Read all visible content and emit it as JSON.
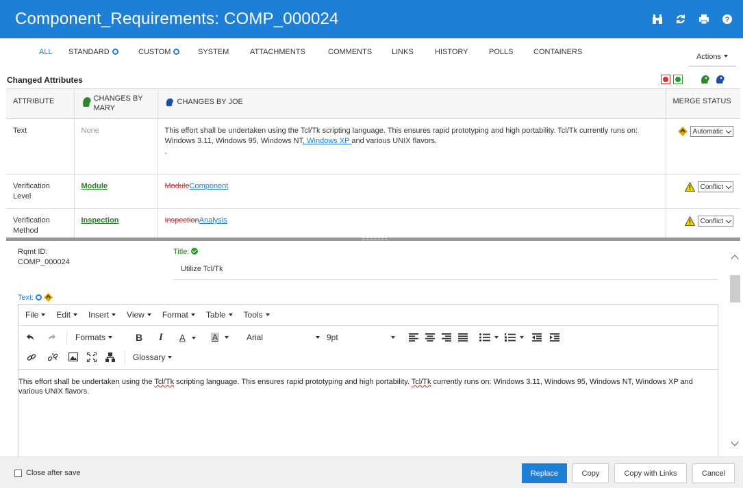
{
  "header": {
    "title": "Component_Requirements: COMP_000024",
    "icons": [
      "binoculars-icon",
      "refresh-icon",
      "print-icon",
      "help-icon"
    ]
  },
  "tabs": [
    {
      "label": "ALL",
      "active": true,
      "dot": false
    },
    {
      "label": "STANDARD",
      "active": false,
      "dot": true
    },
    {
      "label": "CUSTOM",
      "active": false,
      "dot": true
    },
    {
      "label": "SYSTEM",
      "active": false,
      "dot": false
    },
    {
      "label": "ATTACHMENTS",
      "active": false,
      "dot": false
    },
    {
      "label": "COMMENTS",
      "active": false,
      "dot": false
    },
    {
      "label": "LINKS",
      "active": false,
      "dot": false
    },
    {
      "label": "HISTORY",
      "active": false,
      "dot": false
    },
    {
      "label": "POLLS",
      "active": false,
      "dot": false
    },
    {
      "label": "CONTAINERS",
      "active": false,
      "dot": false
    }
  ],
  "actions_label": "Actions",
  "changed_attributes": {
    "title": "Changed Attributes",
    "columns": {
      "attribute": "ATTRIBUTE",
      "mary_line1": "CHANGES BY",
      "mary_line2": "MARY",
      "joe": "CHANGES BY JOE",
      "merge": "MERGE STATUS"
    },
    "rows": [
      {
        "attribute": "Text",
        "mary": "None",
        "joe_text": "This effort shall be undertaken using the Tcl/Tk scripting language. This ensures rapid prototyping and high portability. Tcl/Tk currently runs on: Windows 3.11, Windows 95, Windows NT",
        "joe_insert": ", Windows XP ",
        "joe_tail": "and various UNIX flavors.",
        "joe_extra": "-",
        "merge": "Automatic"
      },
      {
        "attribute": "Verification Level",
        "mary": "Module",
        "joe_deleted": "Module",
        "joe_inserted": "Component",
        "merge": "Conflict"
      },
      {
        "attribute": "Verification Method",
        "mary": "Inspection",
        "joe_deleted": "Inspection",
        "joe_inserted": "Analysis",
        "merge": "Conflict"
      }
    ]
  },
  "detail": {
    "rqmt_label": "Rqmt ID:",
    "rqmt_value": "COMP_000024",
    "title_label": "Title:",
    "title_value": "Utilize Tcl/Tk",
    "text_label": "Text:"
  },
  "editor": {
    "menus": [
      "File",
      "Edit",
      "Insert",
      "View",
      "Format",
      "Table",
      "Tools"
    ],
    "formats_label": "Formats",
    "font": "Arial",
    "size": "9pt",
    "glossary_label": "Glossary",
    "content_a": "This effort shall be undertaken using the ",
    "content_spell1": "Tcl/Tk",
    "content_b": " scripting language. This ensures rapid prototyping and high portability. ",
    "content_spell2": "Tcl/Tk",
    "content_c": " currently runs on: Windows 3.11, Windows 95, Windows NT, Windows XP and various UNIX flavors."
  },
  "footer": {
    "close_after_save": "Close after save",
    "replace": "Replace",
    "copy": "Copy",
    "copy_with_links": "Copy with Links",
    "cancel": "Cancel"
  },
  "colors": {
    "brand": "#1e7fd6",
    "green": "#2a7d2a",
    "deleted": "#cc3333"
  }
}
